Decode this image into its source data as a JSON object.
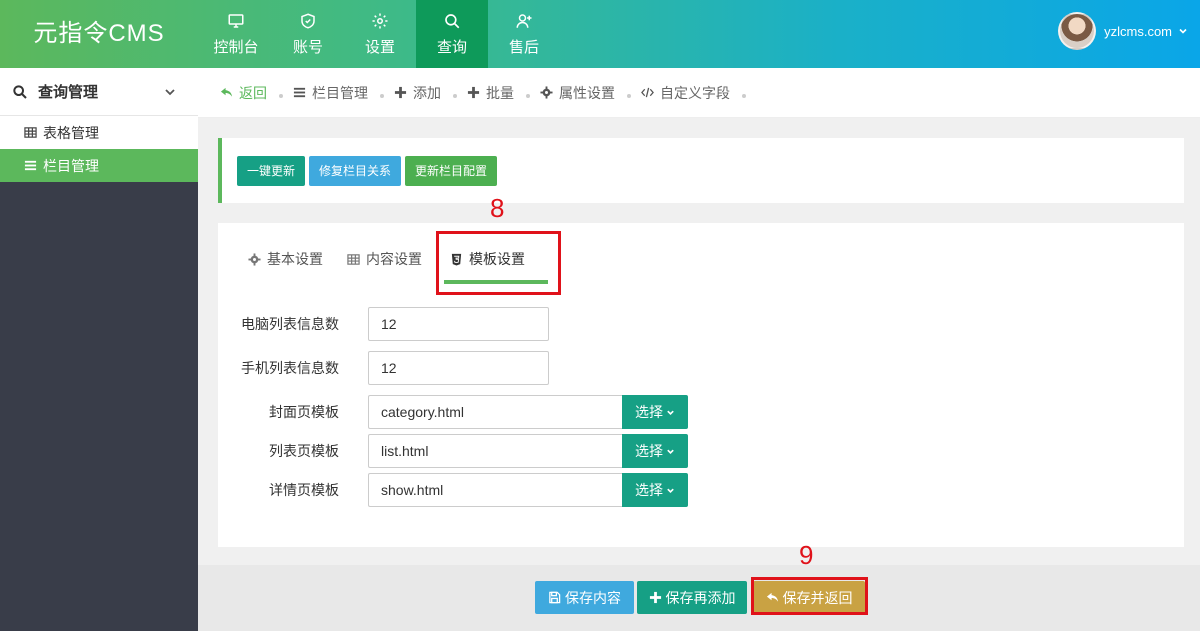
{
  "app": {
    "logo": "元指令CMS"
  },
  "nav": [
    {
      "label": "控制台",
      "icon": "monitor-icon"
    },
    {
      "label": "账号",
      "icon": "shield-icon"
    },
    {
      "label": "设置",
      "icon": "gear-icon"
    },
    {
      "label": "查询",
      "icon": "search-icon",
      "active": true
    },
    {
      "label": "售后",
      "icon": "user-plus-icon"
    }
  ],
  "user": {
    "name": "yzlcms.com"
  },
  "sidebar": {
    "title": "查询管理",
    "items": [
      {
        "label": "表格管理",
        "icon": "table-icon"
      },
      {
        "label": "栏目管理",
        "icon": "list-icon",
        "active": true
      }
    ]
  },
  "toolbar": {
    "items": [
      {
        "label": "返回",
        "icon": "back-icon"
      },
      {
        "label": "栏目管理",
        "icon": "list-icon"
      },
      {
        "label": "添加",
        "icon": "plus-icon"
      },
      {
        "label": "批量",
        "icon": "plus-icon"
      },
      {
        "label": "属性设置",
        "icon": "gear-icon"
      },
      {
        "label": "自定义字段",
        "icon": "code-icon"
      }
    ]
  },
  "actions": {
    "update_all": "一键更新",
    "fix_relations": "修复栏目关系",
    "update_config": "更新栏目配置"
  },
  "tabs": [
    {
      "label": "基本设置",
      "icon": "gear-icon"
    },
    {
      "label": "内容设置",
      "icon": "table-icon"
    },
    {
      "label": "模板设置",
      "icon": "html5-icon",
      "active": true
    }
  ],
  "form": {
    "pc_list_count": {
      "label": "电脑列表信息数",
      "value": "12"
    },
    "mobile_list_count": {
      "label": "手机列表信息数",
      "value": "12"
    },
    "cover_template": {
      "label": "封面页模板",
      "value": "category.html"
    },
    "list_template": {
      "label": "列表页模板",
      "value": "list.html"
    },
    "detail_template": {
      "label": "详情页模板",
      "value": "show.html"
    },
    "select_label": "选择"
  },
  "footer": {
    "save": "保存内容",
    "save_add": "保存再添加",
    "save_return": "保存并返回"
  },
  "annotations": {
    "step_tab": "8",
    "step_save": "9"
  },
  "colors": {
    "accent_green": "#5cb85c",
    "teal": "#16a085",
    "sky": "#3fa9de",
    "gold": "#c9a243",
    "annotation_red": "#e0121a"
  }
}
